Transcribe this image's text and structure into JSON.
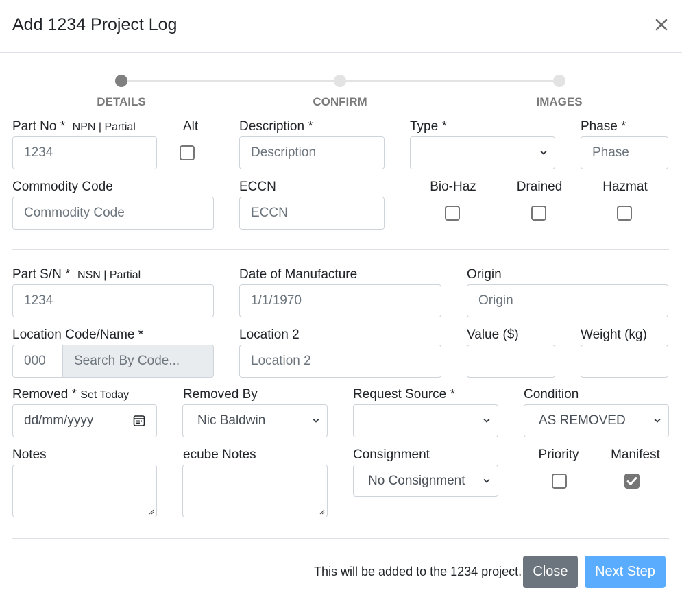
{
  "modal": {
    "title": "Add 1234 Project Log",
    "close_icon": "close-icon"
  },
  "stepper": {
    "steps": [
      {
        "label": "DETAILS",
        "active": true
      },
      {
        "label": "CONFIRM",
        "active": false
      },
      {
        "label": "IMAGES",
        "active": false
      }
    ]
  },
  "form": {
    "part_no": {
      "label": "Part No *",
      "hint": "NPN | Partial",
      "value": "1234"
    },
    "alt": {
      "label": "Alt",
      "checked": false
    },
    "description": {
      "label": "Description *",
      "placeholder": "Description"
    },
    "type": {
      "label": "Type *",
      "value": ""
    },
    "phase": {
      "label": "Phase *",
      "placeholder": "Phase"
    },
    "commodity_code": {
      "label": "Commodity Code",
      "placeholder": "Commodity Code"
    },
    "eccn": {
      "label": "ECCN",
      "placeholder": "ECCN"
    },
    "bio_haz": {
      "label": "Bio-Haz",
      "checked": false
    },
    "drained": {
      "label": "Drained",
      "checked": false
    },
    "hazmat": {
      "label": "Hazmat",
      "checked": false
    },
    "part_sn": {
      "label": "Part S/N *",
      "hint": "NSN | Partial",
      "value": "1234"
    },
    "date_of_manufacture": {
      "label": "Date of Manufacture",
      "value": "1/1/1970"
    },
    "origin": {
      "label": "Origin",
      "placeholder": "Origin"
    },
    "location_code": {
      "label": "Location Code/Name *",
      "code_placeholder": "000",
      "search_placeholder": "Search By Code..."
    },
    "location_2": {
      "label": "Location 2",
      "placeholder": "Location 2"
    },
    "value": {
      "label": "Value ($)",
      "value": ""
    },
    "weight": {
      "label": "Weight (kg)",
      "value": ""
    },
    "removed": {
      "label": "Removed *",
      "hint": "Set Today",
      "placeholder": "dd/mm/yyyy",
      "icon": "calendar-icon"
    },
    "removed_by": {
      "label": "Removed By",
      "value": "Nic Baldwin"
    },
    "request_source": {
      "label": "Request Source *",
      "value": ""
    },
    "condition": {
      "label": "Condition",
      "value": "AS REMOVED"
    },
    "notes": {
      "label": "Notes",
      "value": ""
    },
    "ecube_notes": {
      "label": "ecube Notes",
      "value": ""
    },
    "consignment": {
      "label": "Consignment",
      "value": "No Consignment"
    },
    "priority": {
      "label": "Priority",
      "checked": false
    },
    "manifest": {
      "label": "Manifest",
      "checked": true
    }
  },
  "footer": {
    "info_text": "This will be added to the 1234 project.",
    "close_label": "Close",
    "next_label": "Next Step"
  },
  "colors": {
    "primary_button": "#5aacff",
    "secondary_button": "#6c757d",
    "step_active": "#808080",
    "step_inactive": "#e3e3e3"
  }
}
